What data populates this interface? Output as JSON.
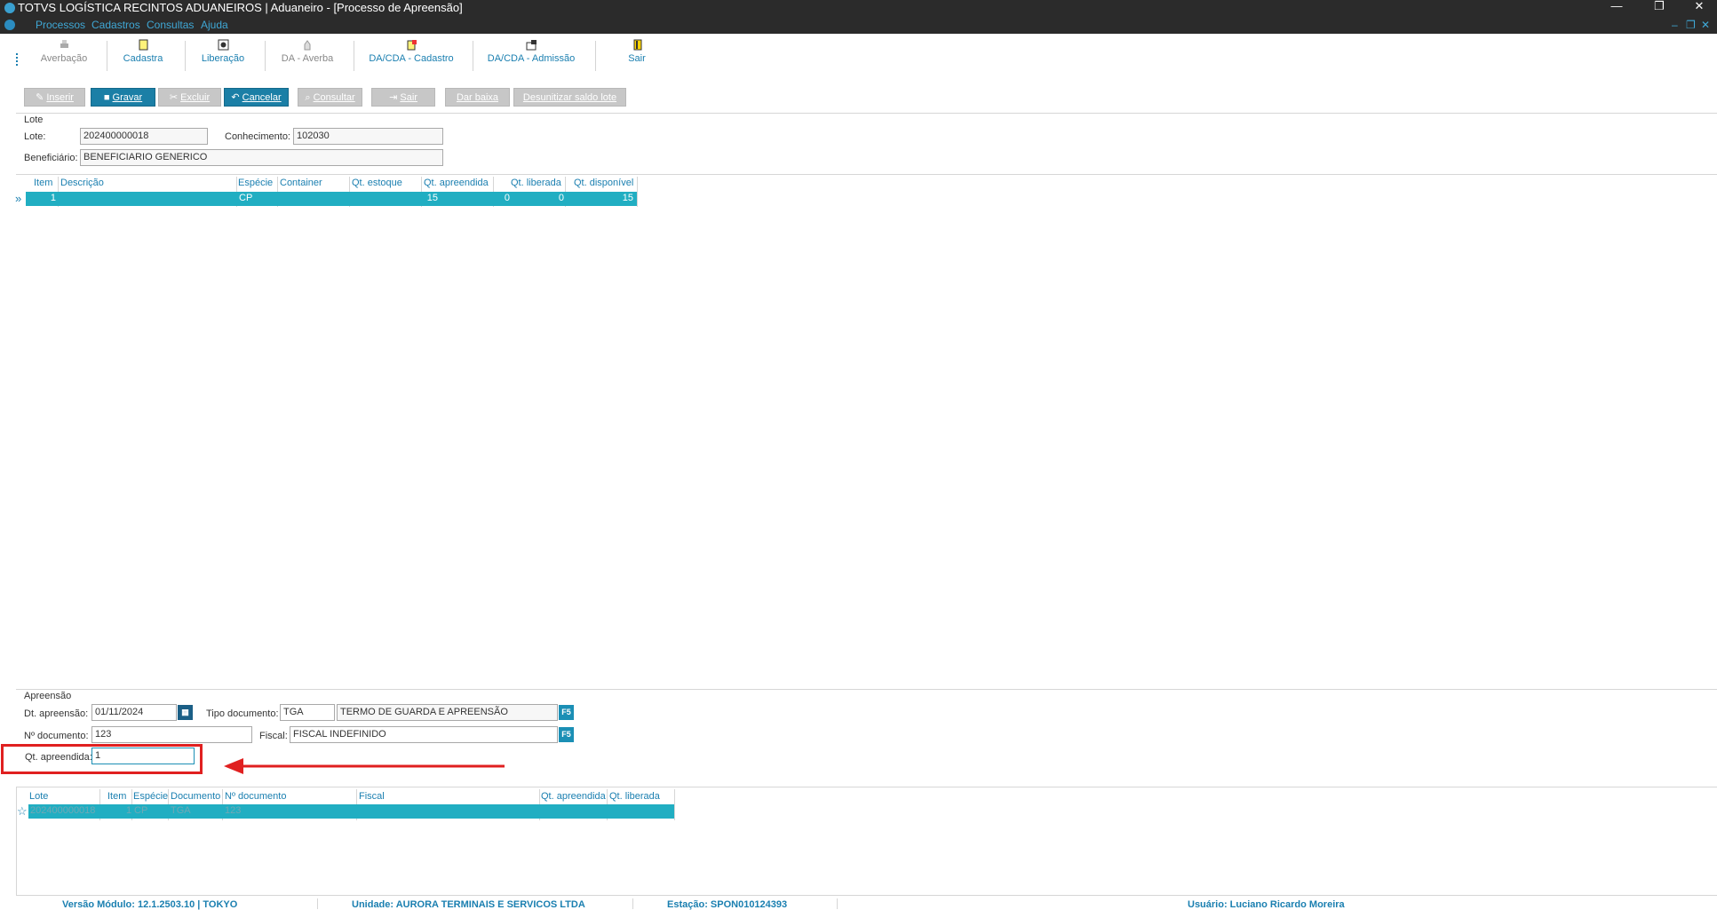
{
  "window": {
    "title": "TOTVS LOGÍSTICA RECINTOS ADUANEIROS | Aduaneiro - [Processo de Apreensão]"
  },
  "menu": [
    "Processos",
    "Cadastros",
    "Consultas",
    "Ajuda"
  ],
  "toolbar": [
    {
      "label": "Averbação",
      "enabled": false
    },
    {
      "label": "Cadastra",
      "enabled": true
    },
    {
      "label": "Liberação",
      "enabled": true
    },
    {
      "label": "DA - Averba",
      "enabled": false
    },
    {
      "label": "DA/CDA - Cadastro",
      "enabled": true
    },
    {
      "label": "DA/CDA - Admissão",
      "enabled": true
    },
    {
      "label": "Sair",
      "enabled": true
    }
  ],
  "actions": {
    "inserir": "Inserir",
    "gravar": "Gravar",
    "excluir": "Excluir",
    "cancelar": "Cancelar",
    "consultar": "Consultar",
    "sair": "Sair",
    "dar_baixa": "Dar baixa",
    "desunitizar": "Desunitizar saldo lote"
  },
  "lote_section": {
    "title": "Lote",
    "lote_label": "Lote:",
    "lote_value": "202400000018",
    "conhecimento_label": "Conhecimento:",
    "conhecimento_value": "102030",
    "beneficiario_label": "Beneficiário:",
    "beneficiario_value": "BENEFICIARIO GENERICO"
  },
  "items_grid": {
    "headers": [
      "Item",
      "Descrição",
      "Espécie",
      "Container",
      "Qt. estoque",
      "Qt. apreendida",
      "Qt. liberada",
      "Qt. disponível"
    ],
    "rows": [
      [
        "1",
        "",
        "CP",
        "",
        "15",
        "0",
        "0",
        "15"
      ]
    ]
  },
  "apreensao_section": {
    "title": "Apreensão",
    "dt_label": "Dt. apreensão:",
    "dt_value": "01/11/2024",
    "tipo_label": "Tipo documento:",
    "tipo_code": "TGA",
    "tipo_desc": "TERMO DE GUARDA E APREENSÃO",
    "ndoc_label": "Nº documento:",
    "ndoc_value": "123",
    "fiscal_label": "Fiscal:",
    "fiscal_value": "FISCAL INDEFINIDO",
    "qt_label": "Qt. apreendida:",
    "qt_value": "1",
    "f5": "F5"
  },
  "apreensao_grid": {
    "headers": [
      "Lote",
      "Item",
      "Espécie",
      "Documento",
      "Nº documento",
      "Fiscal",
      "Qt. apreendida",
      "Qt. liberada"
    ],
    "rows": [
      [
        "202400000018",
        "1",
        "CP",
        "TGA",
        "123",
        "",
        "",
        ""
      ]
    ]
  },
  "status": {
    "versao": "Versão Módulo:  12.1.2503.10  |  TOKYO",
    "unidade": "Unidade: AURORA TERMINAIS E SERVICOS LTDA",
    "estacao": "Estação: SPON010124393",
    "usuario": "Usuário: Luciano Ricardo Moreira"
  },
  "colors": {
    "accent": "#21aec2",
    "link": "#1a7fb0",
    "annotation": "#e02020"
  }
}
